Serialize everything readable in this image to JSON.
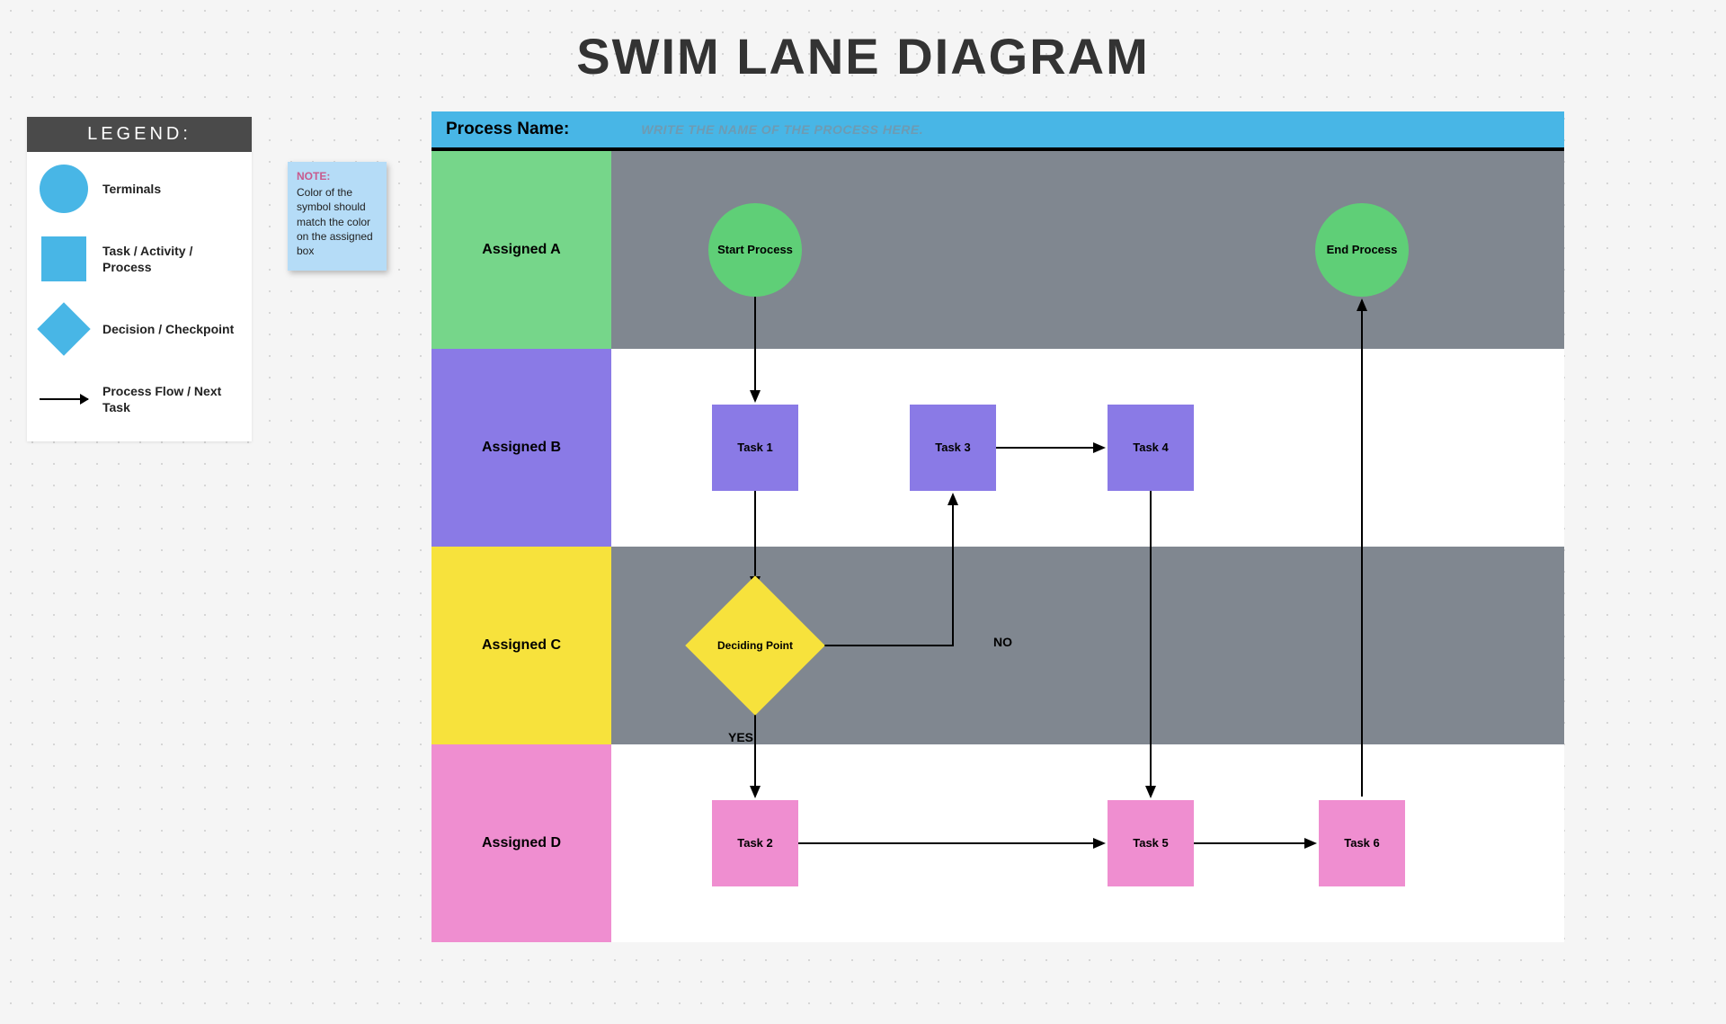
{
  "title": "SWIM LANE DIAGRAM",
  "legend": {
    "header": "LEGEND:",
    "items": [
      {
        "label": "Terminals"
      },
      {
        "label": "Task / Activity / Process"
      },
      {
        "label": "Decision / Checkpoint"
      },
      {
        "label": "Process Flow / Next Task"
      }
    ]
  },
  "note": {
    "title": "NOTE:",
    "body": "Color of the symbol should match the color on the assigned box"
  },
  "process": {
    "label": "Process Name:",
    "placeholder": "WRITE THE NAME OF THE PROCESS HERE."
  },
  "lanes": {
    "a": "Assigned A",
    "b": "Assigned B",
    "c": "Assigned C",
    "d": "Assigned D"
  },
  "nodes": {
    "start": "Start Process",
    "end": "End Process",
    "task1": "Task 1",
    "task2": "Task 2",
    "task3": "Task 3",
    "task4": "Task 4",
    "task5": "Task 5",
    "task6": "Task 6",
    "decision": "Deciding Point"
  },
  "flow_labels": {
    "yes": "YES",
    "no": "NO"
  },
  "colors": {
    "laneA": "#76d68a",
    "laneB": "#8a7ae6",
    "laneC": "#f7e23c",
    "laneD": "#ef8ed0",
    "terminal": "#5fcf77",
    "headerBlue": "#48b6e6",
    "greyLane": "#808790"
  }
}
